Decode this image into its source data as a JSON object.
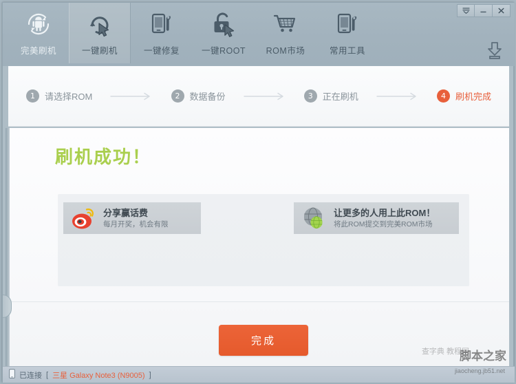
{
  "window": {
    "controls": [
      {
        "name": "menu",
        "glyph": "menu-chevron-icon"
      },
      {
        "name": "minimize",
        "glyph": "minimize-icon"
      },
      {
        "name": "close",
        "glyph": "close-icon"
      }
    ]
  },
  "toolbar": {
    "tabs": [
      {
        "id": "perfect-flash",
        "label": "完美刷机",
        "icon": "android-refresh-icon",
        "active": false
      },
      {
        "id": "one-key-flash",
        "label": "一键刷机",
        "icon": "cursor-refresh-icon",
        "active": true
      },
      {
        "id": "one-key-repair",
        "label": "一键修复",
        "icon": "phone-wrench-icon",
        "active": false
      },
      {
        "id": "one-key-root",
        "label": "一键ROOT",
        "icon": "padlock-cursor-icon",
        "active": false
      },
      {
        "id": "rom-market",
        "label": "ROM市场",
        "icon": "shopping-cart-icon",
        "active": false
      },
      {
        "id": "common-tools",
        "label": "常用工具",
        "icon": "phone-tools-icon",
        "active": false
      }
    ],
    "download_icon": "download-icon"
  },
  "steps": [
    {
      "num": "1",
      "label": "请选择ROM",
      "state": "pending"
    },
    {
      "num": "2",
      "label": "数据备份",
      "state": "pending"
    },
    {
      "num": "3",
      "label": "正在刷机",
      "state": "pending"
    },
    {
      "num": "4",
      "label": "刷机完成",
      "state": "done"
    }
  ],
  "main": {
    "success_title": "刷机成功！",
    "promos": [
      {
        "id": "weibo-share",
        "icon": "weibo-icon",
        "title": "分享赢话费",
        "subtitle": "每月开奖，机会有限"
      },
      {
        "id": "submit-rom",
        "icon": "globe-icon",
        "title": "让更多的人用上此ROM！",
        "subtitle": "将此ROM提交到完美ROM市场"
      }
    ]
  },
  "footer": {
    "finish_label": "完成"
  },
  "statusbar": {
    "phone_icon": "phone-icon",
    "connected_label": "已连接",
    "bracket_open": "[",
    "device": "三星 Galaxy Note3 (N9005)",
    "bracket_close": "]"
  },
  "watermark": {
    "main": "脚本之家",
    "sub": "jiaocheng.jb51.net",
    "side": "查字典  教程网"
  },
  "colors": {
    "accent_orange": "#e8603c",
    "success_green": "#aacf4e",
    "toolbar_blue_gray": "#a3b3be",
    "panel_white": "#fbfcfd"
  }
}
